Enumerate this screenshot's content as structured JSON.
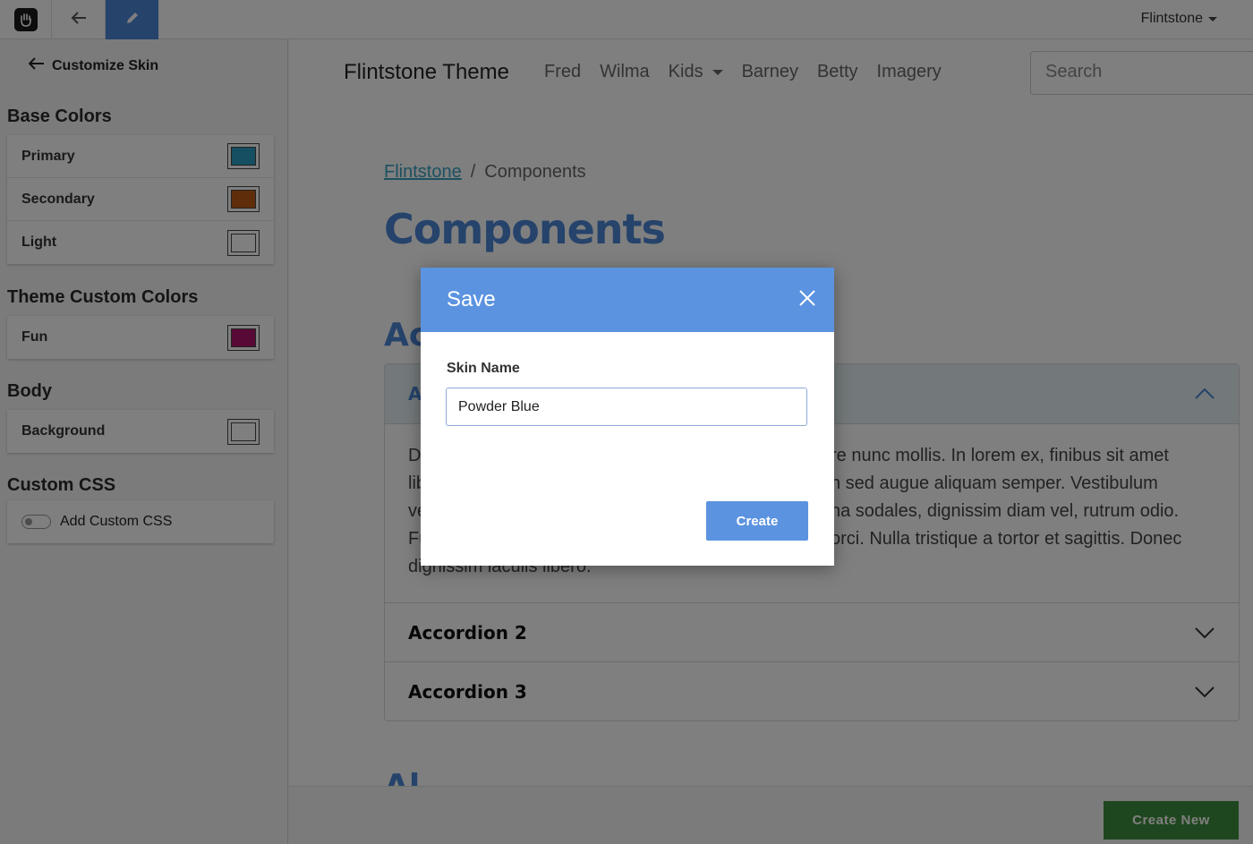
{
  "toolbar": {
    "logo_icon": "concrete-hand-logo-icon",
    "back_icon": "arrow-left-icon",
    "edit_icon": "pencil-icon",
    "user_menu_label": "Flintstone"
  },
  "panel": {
    "back_label": "Customize Skin",
    "sections": {
      "base_colors": {
        "title": "Base Colors",
        "items": [
          {
            "label": "Primary",
            "color": "#2a9fc2"
          },
          {
            "label": "Secondary",
            "color": "#c05a17"
          },
          {
            "label": "Light",
            "color": "#ffffff"
          }
        ]
      },
      "theme_custom_colors": {
        "title": "Theme Custom Colors",
        "items": [
          {
            "label": "Fun",
            "color": "#b0126c"
          }
        ]
      },
      "body": {
        "title": "Body",
        "items": [
          {
            "label": "Background",
            "color": "#ffffff"
          }
        ]
      },
      "custom_css": {
        "title": "Custom CSS",
        "toggle_label": "Add Custom CSS"
      }
    }
  },
  "site": {
    "brand": "Flintstone Theme",
    "nav": [
      "Fred",
      "Wilma",
      "Kids",
      "Barney",
      "Betty",
      "Imagery"
    ],
    "search_placeholder": "Search",
    "breadcrumb": {
      "home": "Flintstone",
      "separator": "/",
      "current": "Components"
    },
    "page_title": "Components",
    "section_accordion_partial": "Ac",
    "section_alerts_partial": "Al",
    "accordion": {
      "item1_partial": "A",
      "body_left_lines": [
        "D",
        "lib",
        "ve",
        "Fu",
        "dignissim iaculis libero."
      ],
      "body_right_lines": [
        "re nunc mollis. In lorem ex, finibus sit amet",
        "n sed augue aliquam semper. Vestibulum",
        "na sodales, dignissim diam vel, rutrum odio.",
        "orci. Nulla tristique a tortor et sagittis. Donec"
      ],
      "item2": "Accordion 2",
      "item3": "Accordion 3"
    },
    "create_new_label": "Create New"
  },
  "modal": {
    "title": "Save",
    "close_icon": "close-x-icon",
    "field_label": "Skin Name",
    "field_value": "Powder Blue",
    "create_label": "Create"
  },
  "colors": {
    "accent": "#4a86d6",
    "modal_header": "#5b93e0",
    "create_new_green": "#3f8f3f"
  }
}
